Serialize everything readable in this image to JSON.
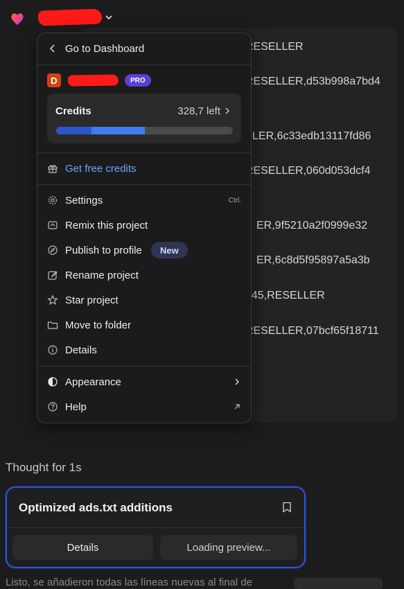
{
  "topbar": {
    "logo_icon": "heart-gradient-logo",
    "chevron_icon": "chevron-down-icon"
  },
  "background_code": {
    "lines": [
      "RESELLER",
      "RESELLER,d53b998a7bd4",
      "LER,6c33edb13117fd86",
      "RESELLER,060d053dcf4",
      "ER,9f5210a2f0999e32",
      "ER,6c8d5f95897a5a3b",
      "445,RESELLER",
      "RESELLER,07bcf65f18711"
    ]
  },
  "menu": {
    "back_label": "Go to Dashboard",
    "avatar_letter": "D",
    "plan_badge": "PRO",
    "credits": {
      "title": "Credits",
      "left_text": "328,7 left",
      "used_fraction": 0.2,
      "remaining_fraction": 0.3
    },
    "free_credits_label": "Get free credits",
    "items": [
      {
        "label": "Settings",
        "icon": "gear-icon",
        "shortcut": "Ctrl."
      },
      {
        "label": "Remix this project",
        "icon": "remix-icon"
      },
      {
        "label": "Publish to profile",
        "icon": "compass-icon",
        "badge": "New"
      },
      {
        "label": "Rename project",
        "icon": "pencil-icon"
      },
      {
        "label": "Star project",
        "icon": "star-icon"
      },
      {
        "label": "Move to folder",
        "icon": "folder-icon"
      },
      {
        "label": "Details",
        "icon": "info-icon"
      }
    ],
    "appearance_label": "Appearance",
    "help_label": "Help"
  },
  "thought": {
    "label": "Thought for 1s"
  },
  "task_card": {
    "title": "Optimized ads.txt additions",
    "details_button": "Details",
    "preview_button": "Loading preview..."
  },
  "footer": {
    "partial_text": "Listo, se añadieron todas las líneas nuevas al final de"
  },
  "colors": {
    "accent_blue": "#3f7cf0",
    "link_blue": "#6ea6ff",
    "pro_purple": "#5b3fd4",
    "avatar_orange": "#d14412"
  }
}
